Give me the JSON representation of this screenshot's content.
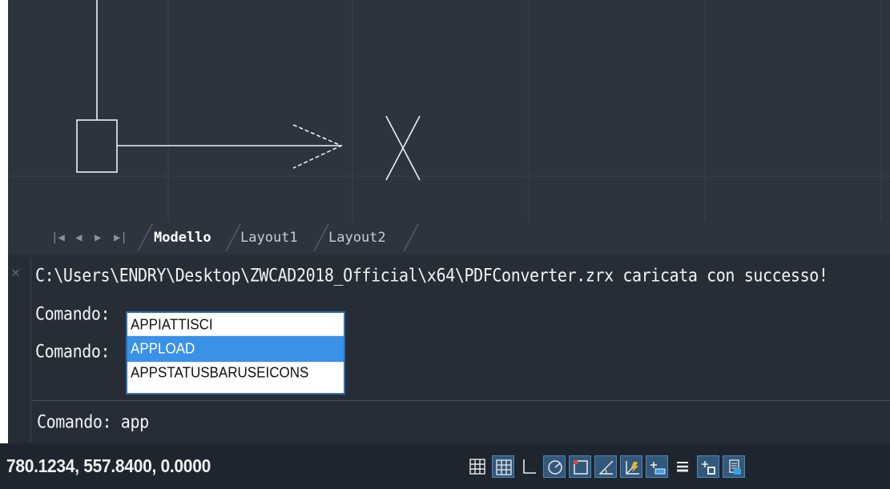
{
  "layout_tabs": [
    {
      "label": "Modello",
      "active": true
    },
    {
      "label": "Layout1",
      "active": false
    },
    {
      "label": "Layout2",
      "active": false
    }
  ],
  "tab_nav": [
    "first",
    "prev",
    "next",
    "last"
  ],
  "command_history": {
    "line1": "C:\\Users\\ENDRY\\Desktop\\ZWCAD2018_Official\\x64\\PDFConverter.zrx caricata con successo!",
    "line2": "Comando:",
    "line3": "Comando:"
  },
  "command_input": {
    "prompt": "Comando:",
    "value": "app"
  },
  "autocomplete": [
    {
      "label": "APPIATTISCI",
      "selected": false
    },
    {
      "label": "APPLOAD",
      "selected": true
    },
    {
      "label": "APPSTATUSBARUSEICONS",
      "selected": false
    }
  ],
  "status": {
    "coordinates": "780.1234, 557.8400, 0.0000"
  },
  "colors": {
    "canvas": "#2c3440",
    "command_panel": "#262d37",
    "selection": "#3a91e8",
    "toggle_on": "#33587a"
  },
  "status_toggles": [
    {
      "icon": "grid-display-icon",
      "on": false
    },
    {
      "icon": "snap-mode-icon",
      "on": true
    },
    {
      "icon": "ortho-mode-icon",
      "on": false
    },
    {
      "icon": "polar-tracking-icon",
      "on": true
    },
    {
      "icon": "object-snap-icon",
      "on": true
    },
    {
      "icon": "isometric-drafting-icon",
      "on": true
    },
    {
      "icon": "dynamic-ucs-icon",
      "on": true
    },
    {
      "icon": "dynamic-input-icon",
      "on": true
    },
    {
      "icon": "lineweight-icon",
      "on": false
    },
    {
      "icon": "transparency-icon",
      "on": true
    },
    {
      "icon": "selection-cycling-icon",
      "on": true
    }
  ]
}
